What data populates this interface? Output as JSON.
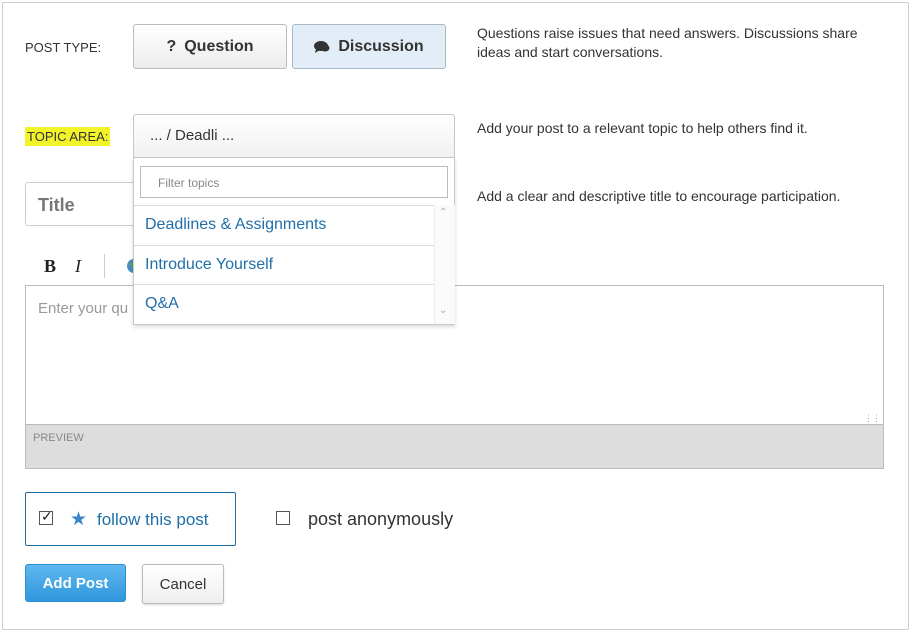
{
  "post_type": {
    "label": "POST TYPE:",
    "question_label": "Question",
    "question_icon": "?",
    "discussion_label": "Discussion",
    "selected": "Discussion",
    "help": "Questions raise issues that need answers. Discussions share ideas and start conversations."
  },
  "topic_area": {
    "label": "TOPIC AREA:",
    "selected_value": "... / Deadli ...",
    "help": "Add your post to a relevant topic to help others find it.",
    "filter_placeholder": "Filter topics",
    "options": [
      "Deadlines & Assignments",
      "Introduce Yourself",
      "Q&A"
    ]
  },
  "title": {
    "placeholder": "Title",
    "help": "Add a clear and descriptive title to encourage participation."
  },
  "toolbar": {
    "bold": "B",
    "italic": "I"
  },
  "editor": {
    "placeholder": "Enter your qu",
    "preview_label": "PREVIEW"
  },
  "options": {
    "follow_label": "follow this post",
    "follow_checked": true,
    "anonymous_label": "post anonymously",
    "anonymous_checked": false
  },
  "actions": {
    "add_label": "Add Post",
    "cancel_label": "Cancel"
  },
  "colors": {
    "accent": "#1f6fa8",
    "primary_button": "#2f97dc",
    "highlight": "#f3f32a"
  }
}
